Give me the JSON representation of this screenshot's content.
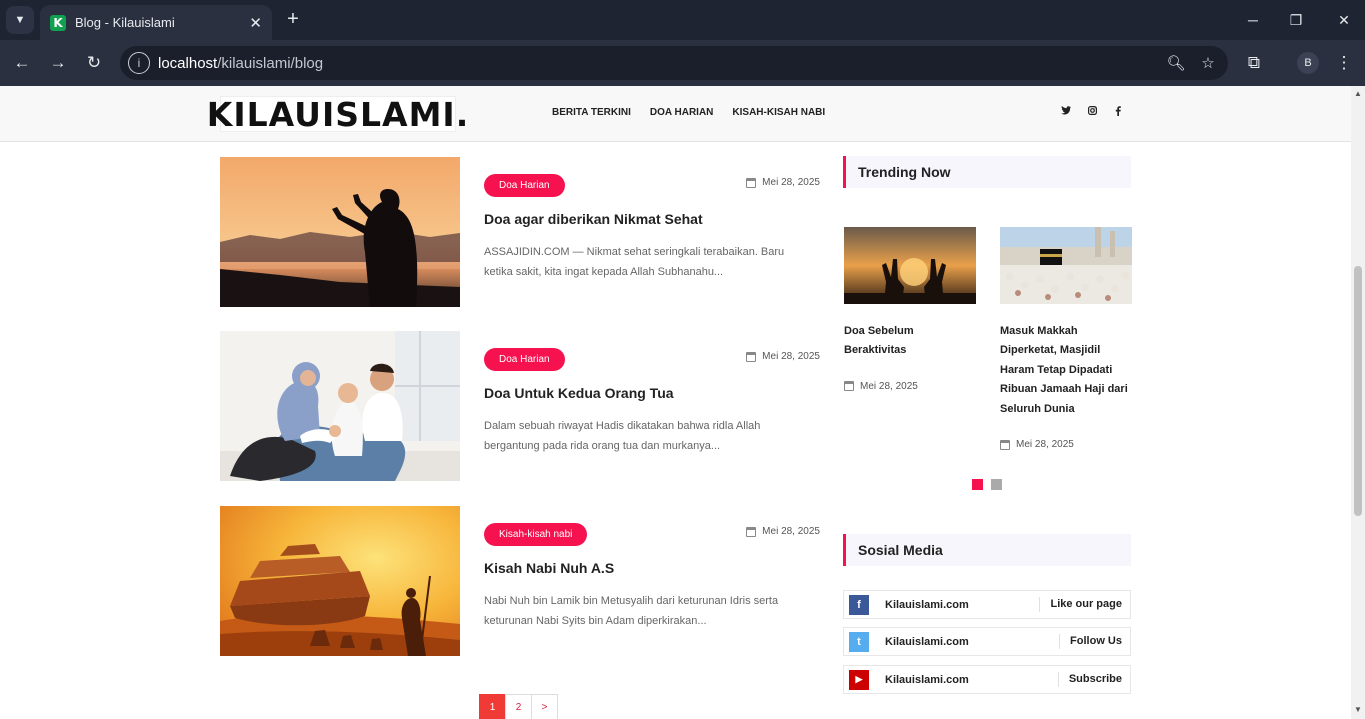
{
  "browser": {
    "tab_title": "Blog - Kilauislami",
    "favicon_letter": "K",
    "url_host": "localhost",
    "url_path": "/kilauislami/blog",
    "profile_initial": "B"
  },
  "header": {
    "logo": "KILAUISLAMI.",
    "nav": [
      "BERITA TERKINI",
      "DOA HARIAN",
      "KISAH-KISAH NABI"
    ],
    "social_icons": [
      "twitter-icon",
      "instagram-icon",
      "facebook-icon"
    ]
  },
  "posts": [
    {
      "category": "Doa Harian",
      "date": "Mei 28, 2025",
      "title": "Doa agar diberikan Nikmat Sehat",
      "excerpt": "ASSAJIDIN.COM — Nikmat sehat seringkali terabaikan. Baru ketika sakit, kita ingat kepada Allah Subhanahu..."
    },
    {
      "category": "Doa Harian",
      "date": "Mei 28, 2025",
      "title": "Doa Untuk Kedua Orang Tua",
      "excerpt": "Dalam sebuah riwayat Hadis dikatakan bahwa ridla Allah bergantung pada rida orang tua dan murkanya..."
    },
    {
      "category": "Kisah-kisah nabi",
      "date": "Mei 28, 2025",
      "title": "Kisah Nabi Nuh A.S",
      "excerpt": "Nabi Nuh bin Lamik bin Metusyalih dari keturunan Idris serta keturunan Nabi Syits bin Adam diperkirakan..."
    }
  ],
  "pagination": [
    "1",
    "2",
    ">"
  ],
  "sidebar": {
    "trending_title": "Trending Now",
    "trending": [
      {
        "title": "Doa Sebelum Beraktivitas",
        "date": "Mei 28, 2025"
      },
      {
        "title": "Masuk Makkah Diperketat, Masjidil Haram Tetap Dipadati Ribuan Jamaah Haji dari Seluruh Dunia",
        "date": "Mei 28, 2025"
      }
    ],
    "social_title": "Sosial Media",
    "social": [
      {
        "name": "Kilauislami.com",
        "action": "Like our page",
        "icon": "f",
        "color": "#3b5998"
      },
      {
        "name": "Kilauislami.com",
        "action": "Follow Us",
        "icon": "t",
        "color": "#55acee"
      },
      {
        "name": "Kilauislami.com",
        "action": "Subscribe",
        "icon": "▶",
        "color": "#cc0000"
      }
    ]
  },
  "colors": {
    "accent": "#f5124f",
    "page_active": "#ef3a35"
  }
}
